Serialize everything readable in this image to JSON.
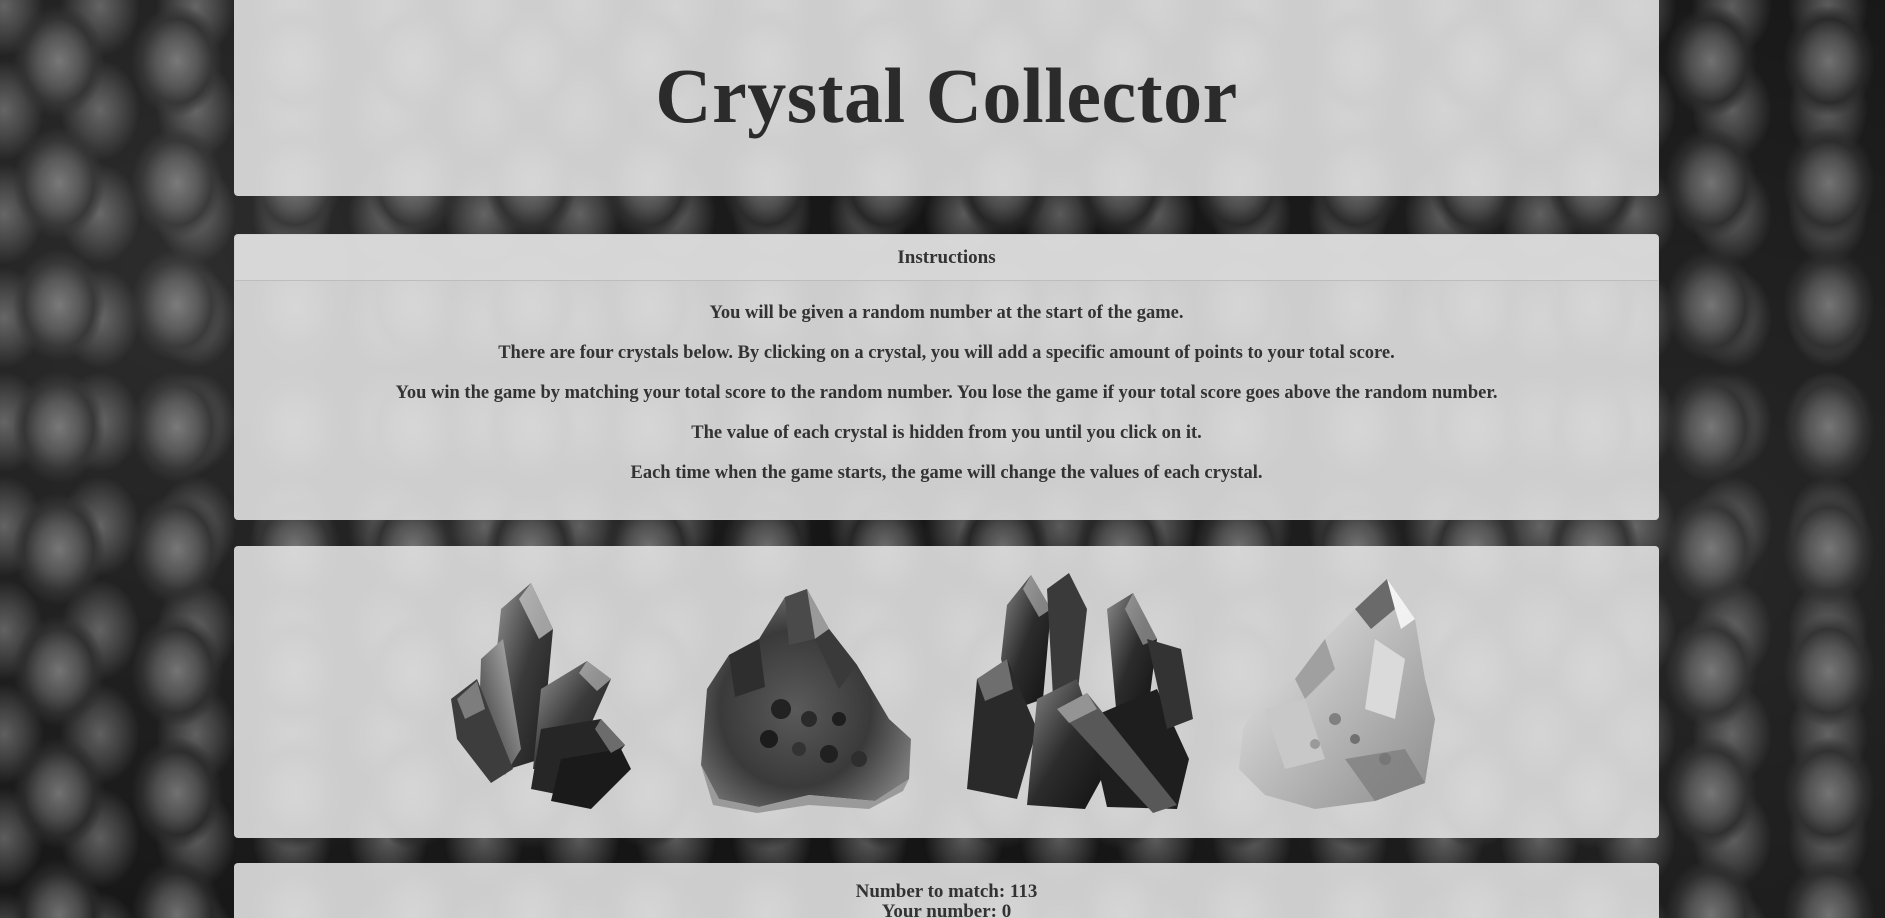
{
  "header": {
    "title": "Crystal Collector"
  },
  "instructions": {
    "heading": "Instructions",
    "lines": [
      "You will be given a random number at the start of the game.",
      "There are four crystals below. By clicking on a crystal, you will add a specific amount of points to your total score.",
      "You win the game by matching your total score to the random number. You lose the game if your total score goes above the random number.",
      "The value of each crystal is hidden from you until you click on it.",
      "Each time when the game starts, the game will change the values of each crystal."
    ]
  },
  "crystals": [
    {
      "name": "crystal-1",
      "icon": "dark-quartz-cluster"
    },
    {
      "name": "crystal-2",
      "icon": "amethyst-geode"
    },
    {
      "name": "crystal-3",
      "icon": "smoky-quartz-cluster"
    },
    {
      "name": "crystal-4",
      "icon": "clear-quartz-cluster"
    }
  ],
  "score": {
    "target_label": "Number to match:",
    "target_value": "113",
    "your_label": "Your number:",
    "your_value": "0"
  }
}
